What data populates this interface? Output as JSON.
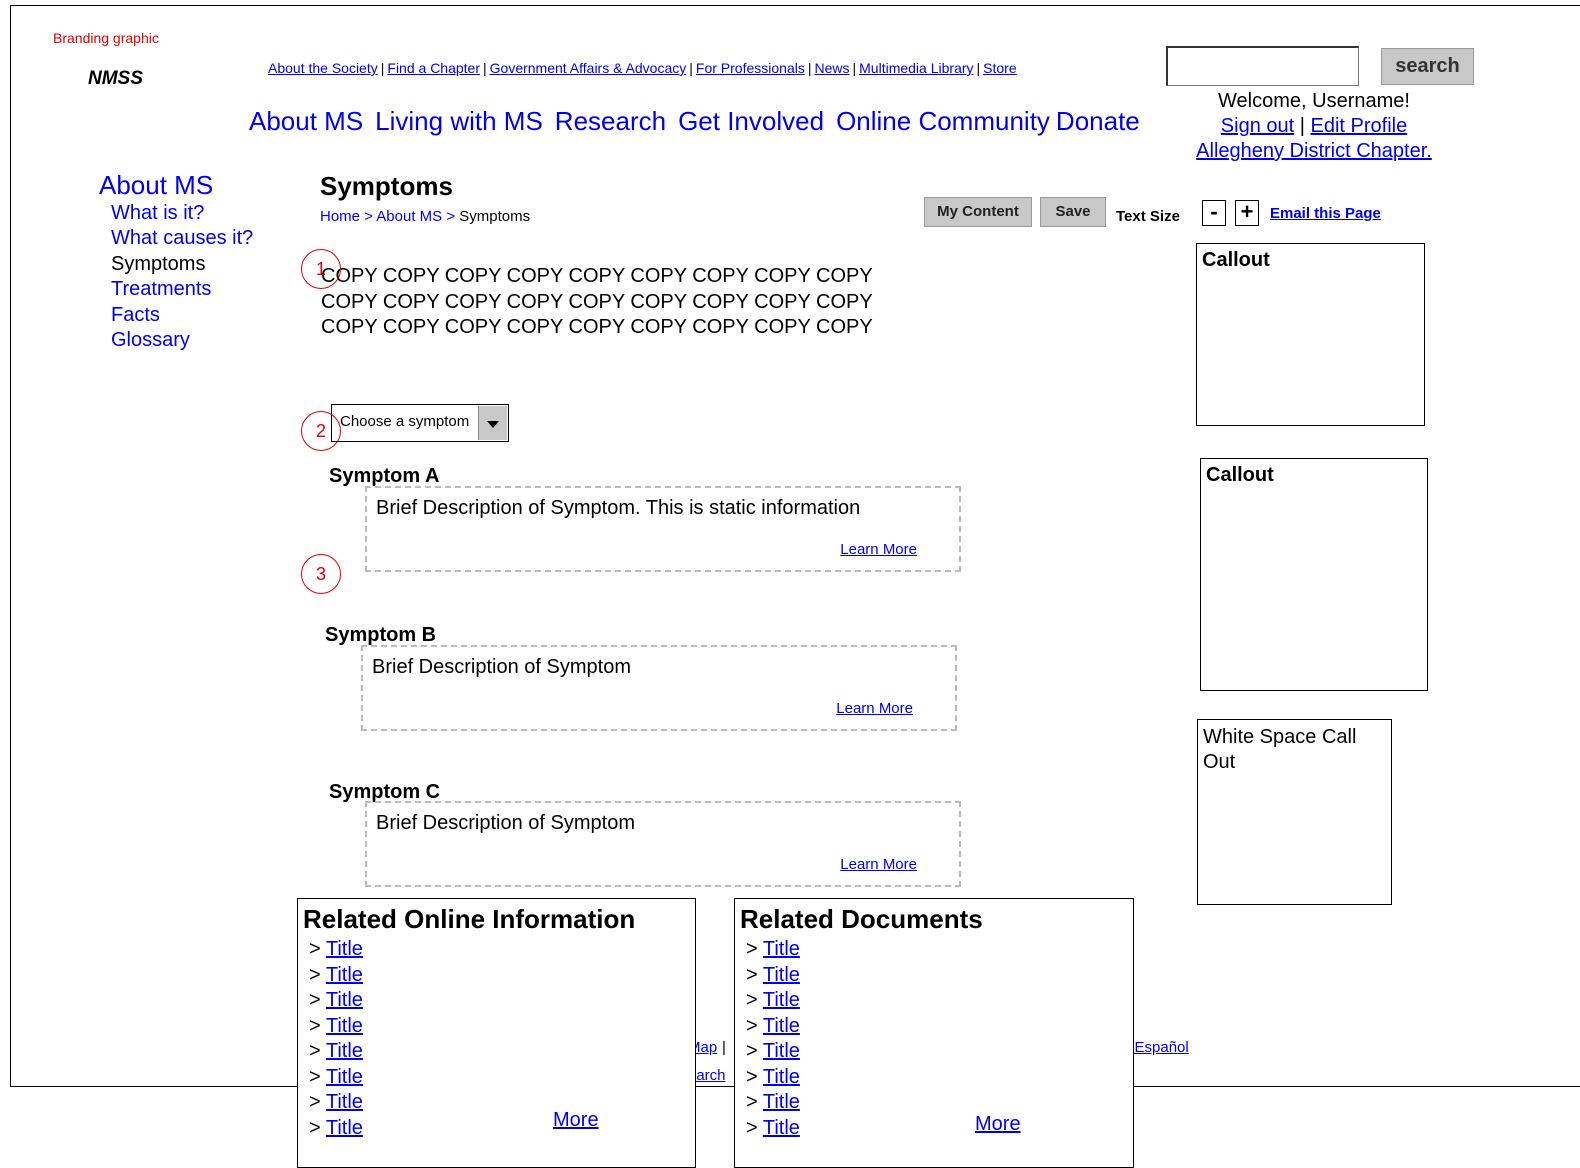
{
  "branding": {
    "graphic_label": "Branding graphic",
    "logo": "NMSS"
  },
  "utility_nav": [
    "About the Society",
    "Find a Chapter",
    "Government Affairs & Advocacy",
    "For Professionals",
    "News",
    "Multimedia Library",
    "Store"
  ],
  "search": {
    "value": "",
    "button_label": "search"
  },
  "main_nav": [
    "About MS",
    "Living with MS",
    "Research",
    "Get Involved",
    "Online Community",
    "Donate"
  ],
  "user": {
    "welcome": "Welcome, Username!",
    "sign_out": "Sign out",
    "separator": "|",
    "edit_profile": "Edit Profile",
    "chapter": "Allegheny District Chapter."
  },
  "sidebar": {
    "title": "About MS",
    "items": [
      {
        "label": "What is it?",
        "current": false
      },
      {
        "label": "What causes it?",
        "current": false
      },
      {
        "label": "Symptoms",
        "current": true
      },
      {
        "label": "Treatments",
        "current": false
      },
      {
        "label": "Facts",
        "current": false
      },
      {
        "label": "Glossary",
        "current": false
      }
    ]
  },
  "page": {
    "title": "Symptoms",
    "breadcrumb": {
      "home": "Home",
      "sep": ">",
      "section": "About MS",
      "current": "Symptoms"
    }
  },
  "toolbar": {
    "my_content": "My Content",
    "save": "Save",
    "text_size": "Text Size",
    "minus": "-",
    "plus": "+",
    "email": "Email this Page"
  },
  "copy": {
    "lines": [
      "COPY COPY COPY COPY COPY COPY COPY COPY COPY",
      "COPY COPY COPY COPY COPY COPY COPY COPY COPY",
      "COPY COPY COPY COPY COPY COPY COPY COPY COPY"
    ]
  },
  "markers": [
    "1",
    "2",
    "3"
  ],
  "symptom_select": {
    "placeholder": "Choose a symptom"
  },
  "symptoms": [
    {
      "title": "Symptom A",
      "description": "Brief Description of Symptom. This is static information",
      "link": "Learn More"
    },
    {
      "title": "Symptom B",
      "description": "Brief Description of Symptom",
      "link": "Learn More"
    },
    {
      "title": "Symptom C",
      "description": "Brief Description of Symptom",
      "link": "Learn More"
    }
  ],
  "callouts": [
    {
      "title": "Callout"
    },
    {
      "title": "Callout"
    },
    {
      "title": "White Space Call Out"
    }
  ],
  "footer": {
    "fragment_1": "Map",
    "fragment_2": "|",
    "fragment_3": "earch",
    "fragment_4": "n Español"
  },
  "related_online": {
    "title": "Related Online Information",
    "items": [
      "Title",
      "Title",
      "Title",
      "Title",
      "Title",
      "Title",
      "Title",
      "Title"
    ],
    "more": "More"
  },
  "related_documents": {
    "title": "Related Documents",
    "items": [
      "Title",
      "Title",
      "Title",
      "Title",
      "Title",
      "Title",
      "Title",
      "Title"
    ],
    "more": "More"
  },
  "colors": {
    "link": "#0000ee",
    "annotation": "#e00000",
    "button_gray": "#c8c8c8"
  }
}
